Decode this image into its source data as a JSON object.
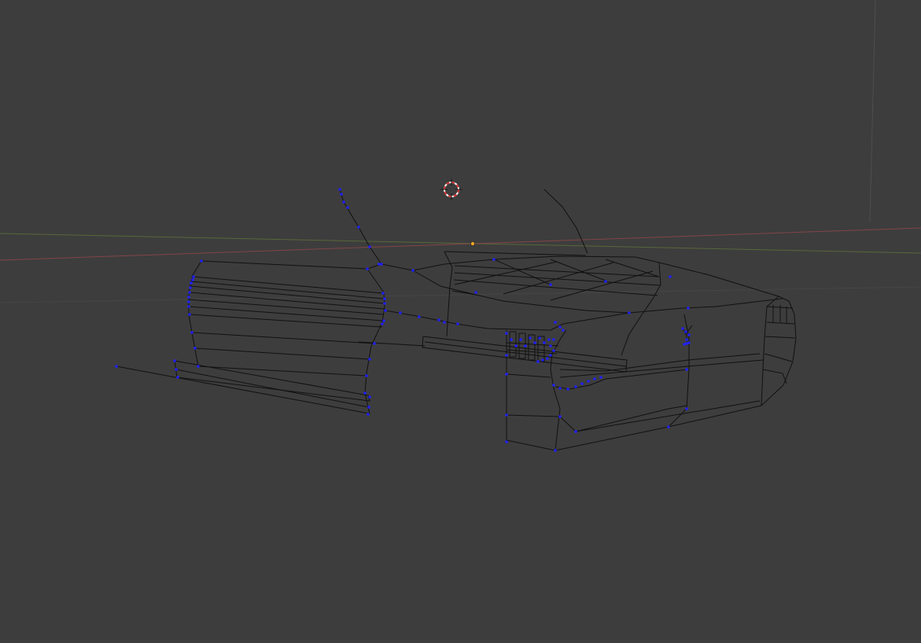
{
  "viewport": {
    "mode": "wireframe-edit",
    "background_color": "#3d3d3d",
    "wire_color": "#111111",
    "vertex_color": "#2020ff",
    "x_axis_color": "#a0474d",
    "y_axis_color": "#6f8a3a",
    "grid_line_color": "#4e4e4e",
    "origin_color": "#f5a623",
    "cursor_color_a": "#d62c2c",
    "cursor_color_b": "#ffffff"
  },
  "icons": {
    "cursor": "3d-cursor-icon",
    "origin": "object-origin-icon"
  }
}
